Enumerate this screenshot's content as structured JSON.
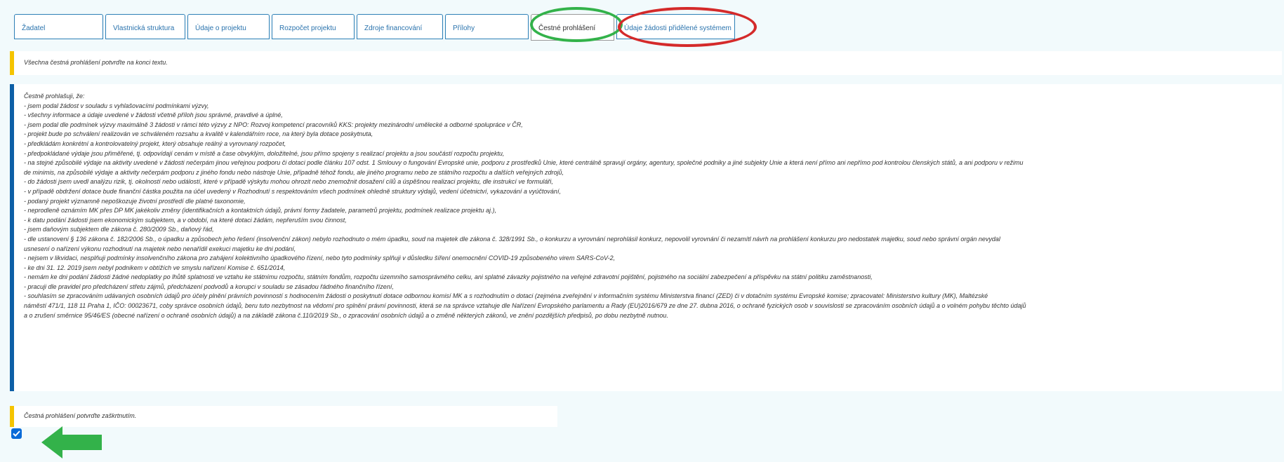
{
  "tabs": [
    {
      "label": "Žadatel",
      "active": false
    },
    {
      "label": "Vlastnická struktura",
      "active": false
    },
    {
      "label": "Údaje o projektu",
      "active": false
    },
    {
      "label": "Rozpočet projektu",
      "active": false
    },
    {
      "label": "Zdroje financování",
      "active": false
    },
    {
      "label": "Přílohy",
      "active": false
    },
    {
      "label": "Čestné prohlášení",
      "active": true
    },
    {
      "label": "Údaje žádosti přidělené systémem",
      "active": false
    }
  ],
  "notice_top": "Všechna čestná prohlášení potvrďte na konci textu.",
  "declaration": {
    "lines": [
      "Čestně prohlašuji, že:",
      "- jsem podal žádost v souladu s vyhlašovacími podmínkami výzvy,",
      "- všechny informace a údaje uvedené v žádosti včetně příloh jsou správné, pravdivé a úplné,",
      "- jsem podal dle podmínek výzvy maximálně 3 žádosti v rámci této výzvy z NPO: Rozvoj kompetencí pracovníků KKS: projekty mezinárodní umělecké a odborné spolupráce v ČR,",
      "- projekt bude po schválení realizován ve schváleném rozsahu a kvalitě v kalendářním roce, na který byla dotace poskytnuta,",
      "- předkládám konkrétní a kontrolovatelný projekt, který obsahuje reálný a vyrovnaný rozpočet,",
      "- předpokládané výdaje jsou přiměřené, tj. odpovídají cenám v místě a čase obvyklým, doložitelné, jsou přímo spojeny s realizací projektu a jsou součástí rozpočtu projektu,",
      "- na stejné způsobilé výdaje na aktivity uvedené v žádosti nečerpám jinou veřejnou podporu či dotaci podle článku 107 odst. 1 Smlouvy o fungování Evropské unie, podporu z prostředků Unie, které centrálně spravují orgány, agentury, společné podniky a jiné subjekty Unie a která není přímo ani nepřímo pod kontrolou členských států, a ani podporu v režimu",
      "de minimis, na způsobilé výdaje a aktivity nečerpám podporu z jiného fondu nebo nástroje Unie, případně téhož fondu, ale jiného programu nebo ze státního rozpočtu a dalších veřejných zdrojů,",
      "- do žádosti jsem uvedl analýzu rizik, tj. okolností nebo událostí, které v případě výskytu mohou ohrozit nebo znemožnit dosažení cílů a úspěšnou realizaci projektu, dle instrukcí ve formuláři,",
      "- v případě obdržení dotace bude finanční částka použita na účel uvedený v Rozhodnutí s respektováním všech podmínek ohledně struktury výdajů, vedení účetnictví, vykazování a vyúčtování,",
      "- podaný projekt významně nepoškozuje životní prostředí dle platné taxonomie,",
      "- neprodleně oznámím MK přes DP MK jakékoliv změny (identifikačních a kontaktních údajů, právní formy žadatele, parametrů projektu, podmínek realizace projektu aj.),",
      "- k datu podání žádosti jsem ekonomickým subjektem, a v období, na které dotaci žádám, nepřeruším svou činnost,",
      "- jsem daňovým subjektem dle zákona č. 280/2009 Sb., daňový řád,",
      "- dle ustanovení § 136 zákona č. 182/2006 Sb., o úpadku a způsobech jeho řešení (insolvenční zákon) nebylo rozhodnuto o mém úpadku, soud na majetek dle zákona č. 328/1991 Sb., o konkurzu a vyrovnání neprohlásil konkurz, nepovolil vyrovnání či nezamítl návrh na prohlášení konkurzu pro nedostatek majetku, soud nebo správní orgán nevydal",
      "usnesení o nařízení výkonu rozhodnutí na majetek nebo nenařídil exekuci majetku ke dni podání,",
      "- nejsem v likvidaci, nesplňuji podmínky insolvenčního zákona pro zahájení kolektivního úpadkového řízení, nebo tyto podmínky splňuji v důsledku šíření onemocnění COVID-19 způsobeného virem SARS-CoV-2,",
      "- ke dni 31. 12. 2019 jsem nebyl podnikem v obtížích ve smyslu nařízení Komise č. 651/2014,",
      "- nemám ke dni podání žádosti žádné nedoplatky po lhůtě splatnosti ve vztahu ke státnímu rozpočtu, státním fondům, rozpočtu územního samosprávného celku, ani splatné závazky pojistného na veřejné zdravotní pojištění, pojistného na sociální zabezpečení a příspěvku na státní politiku zaměstnanosti,",
      "- pracuji dle pravidel pro předcházení střetu zájmů, předcházení podvodů a korupci v souladu se zásadou řádného finančního řízení,",
      "- souhlasím se zpracováním udávaných osobních údajů pro účely plnění právních povinností s hodnocením žádosti o poskytnutí dotace odbornou komisí MK a s rozhodnutím o dotaci (zejména zveřejnění v informačním systému Ministerstva financí (ZED) či v dotačním systému Evropské komise; zpracovatel: Ministerstvo kultury (MK), Maltézské",
      "náměstí 471/1, 118 11 Praha 1, IČO: 00023671, coby správce osobních údajů, beru tuto nezbytnost na vědomí pro splnění právní povinnosti, která se na správce vztahuje dle Nařízení Evropského parlamentu a Rady (EU)2016/679 ze dne 27. dubna 2016, o ochraně fyzických osob v souvislosti se zpracováním osobních údajů a o volném pohybu těchto údajů",
      "a o zrušení směrnice 95/46/ES (obecné nařízení o ochraně osobních údajů) a na základě zákona č.110/2019 Sb., o zpracování osobních údajů a o změně některých zákonů, ve znění pozdějších předpisů, po dobu nezbytně nutnou."
    ]
  },
  "confirm_notice": "Čestná prohlášení potvrďte zaškrtnutím.",
  "confirm_checkbox": {
    "checked": true
  },
  "colors": {
    "tab_border": "#2d7fb6",
    "tab_text": "#2a73ad",
    "info_bar": "#0d5fa6",
    "warn_bar": "#f5c400",
    "page_bg": "#f2fafc",
    "checkbox": "#0a6bd8",
    "annotation_green": "#33b24a",
    "annotation_red": "#d42a2a"
  }
}
